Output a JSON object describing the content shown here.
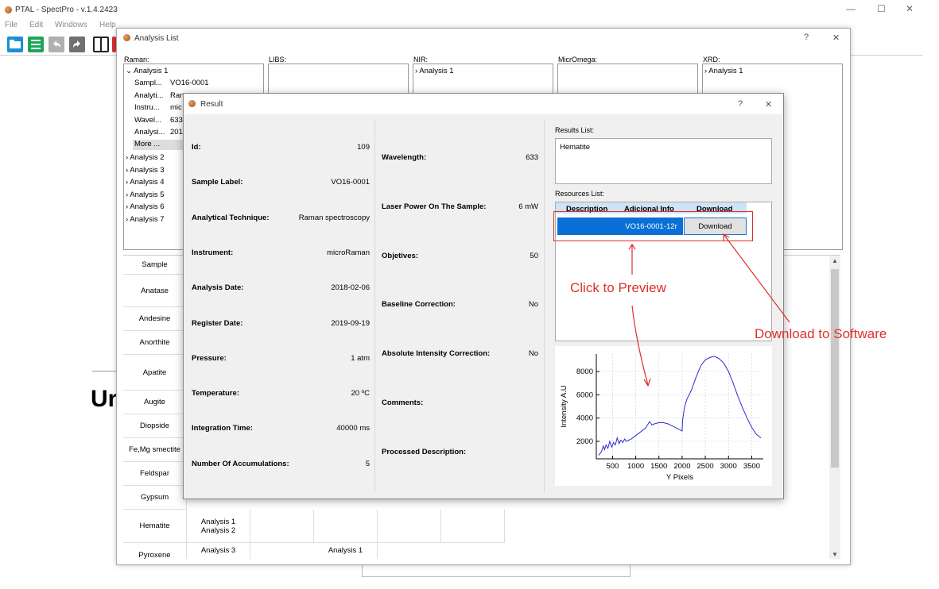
{
  "app": {
    "title": "PTAL - SpectPro -  v.1.4.2423",
    "menu": [
      "File",
      "Edit",
      "Windows",
      "Help"
    ],
    "win_controls": {
      "minimize": "—",
      "maximize": "☐",
      "close": "✕"
    }
  },
  "analysis_list": {
    "title": "Analysis List",
    "help": "?",
    "close": "✕",
    "columns": [
      {
        "label": "Raman:"
      },
      {
        "label": "LIBS:"
      },
      {
        "label": "NIR:"
      },
      {
        "label": "MicrOmega:"
      },
      {
        "label": "XRD:"
      }
    ],
    "raman_tree": {
      "expanded": "Analysis 1",
      "children": [
        {
          "k": "Sampl...",
          "v": "VO16-0001"
        },
        {
          "k": "Analyti...",
          "v": "Ran"
        },
        {
          "k": "Instru...",
          "v": "mic"
        },
        {
          "k": "Wavel...",
          "v": "633"
        },
        {
          "k": "Analysi...",
          "v": "201"
        }
      ],
      "more": "More ...",
      "others": [
        "Analysis 2",
        "Analysis 3",
        "Analysis 4",
        "Analysis 5",
        "Analysis 6",
        "Analysis 7"
      ]
    },
    "nir_tree": [
      "Analysis 1"
    ],
    "xrd_tree": [
      "Analysis 1"
    ],
    "samples": [
      "Sample",
      "Anatase",
      "Andesine",
      "Anorthite",
      "Apatite",
      "Augite",
      "Diopside",
      "Fe,Mg smectite",
      "Feldspar",
      "Gypsum",
      "Hematite",
      "Pyroxene"
    ],
    "hematite_analyses": [
      "Analysis 1",
      "Analysis 2"
    ],
    "pyroxene_analyses": [
      "Analysis 3",
      "Analysis 1"
    ]
  },
  "background": {
    "heading": "Ur"
  },
  "result": {
    "title": "Result",
    "help": "?",
    "close": "✕",
    "left_fields": [
      {
        "label": "Id:",
        "value": "109"
      },
      {
        "label": "Sample Label:",
        "value": "VO16-0001"
      },
      {
        "label": "Analytical Technique:",
        "value": "Raman spectroscopy"
      },
      {
        "label": "Instrument:",
        "value": "microRaman"
      },
      {
        "label": "Analysis Date:",
        "value": "2018-02-06"
      },
      {
        "label": "Register Date:",
        "value": "2019-09-19"
      },
      {
        "label": "Pressure:",
        "value": "1 atm"
      },
      {
        "label": "Temperature:",
        "value": "20 ºC"
      },
      {
        "label": "Integration Time:",
        "value": "40000 ms"
      },
      {
        "label": "Number Of Accumulations:",
        "value": "5"
      }
    ],
    "mid_fields": [
      {
        "label": "Wavelength:",
        "value": "633"
      },
      {
        "label": "Laser Power On The Sample:",
        "value": "6 mW"
      },
      {
        "label": "Objetives:",
        "value": "50"
      },
      {
        "label": "Baseline Correction:",
        "value": "No"
      },
      {
        "label": "Absolute Intensity Correction:",
        "value": "No"
      },
      {
        "label": "Comments:",
        "value": ""
      },
      {
        "label": "Processed Description:",
        "value": ""
      }
    ],
    "results_list_label": "Results List:",
    "results": [
      "Hematite"
    ],
    "resources_list_label": "Resources List:",
    "resources_headers": [
      "Description",
      "Adicional Info",
      "Download"
    ],
    "resource_row": {
      "description": "",
      "info": "VO16-0001-12r",
      "download": "Download"
    }
  },
  "annotations": {
    "preview": "Click to Preview",
    "download": "Download to Software"
  },
  "colors": {
    "annotation": "#e0302a",
    "line": "#2b2bd6",
    "selected": "#0a6fd6"
  },
  "chart_data": {
    "type": "line",
    "xlabel": "Y Pixels",
    "ylabel": "Intensity A.U",
    "xlim": [
      150,
      3750
    ],
    "ylim": [
      500,
      9500
    ],
    "xticks": [
      500,
      1000,
      1500,
      2000,
      2500,
      3000,
      3500
    ],
    "yticks": [
      2000,
      4000,
      6000,
      8000
    ],
    "grid": true,
    "series": [
      {
        "x": [
          200,
          260,
          300,
          330,
          360,
          400,
          440,
          480,
          520,
          560,
          600,
          640,
          680,
          720,
          760,
          800,
          900,
          1000,
          1100,
          1200,
          1300,
          1350,
          1400,
          1500,
          1600,
          1700,
          1800,
          1900,
          2000,
          2010,
          2050,
          2100,
          2200,
          2300,
          2400,
          2500,
          2600,
          2700,
          2800,
          2900,
          3000,
          3100,
          3200,
          3300,
          3400,
          3500,
          3600,
          3700
        ],
        "y": [
          800,
          1100,
          1600,
          1300,
          1700,
          1400,
          2000,
          1500,
          1900,
          1700,
          2300,
          1800,
          2100,
          1900,
          2200,
          2000,
          2200,
          2500,
          2800,
          3100,
          3700,
          3400,
          3500,
          3600,
          3600,
          3500,
          3300,
          3100,
          2900,
          3800,
          4900,
          5600,
          6400,
          7500,
          8500,
          9000,
          9200,
          9300,
          9100,
          8700,
          8000,
          7000,
          5900,
          4900,
          4000,
          3200,
          2600,
          2300
        ]
      }
    ]
  }
}
